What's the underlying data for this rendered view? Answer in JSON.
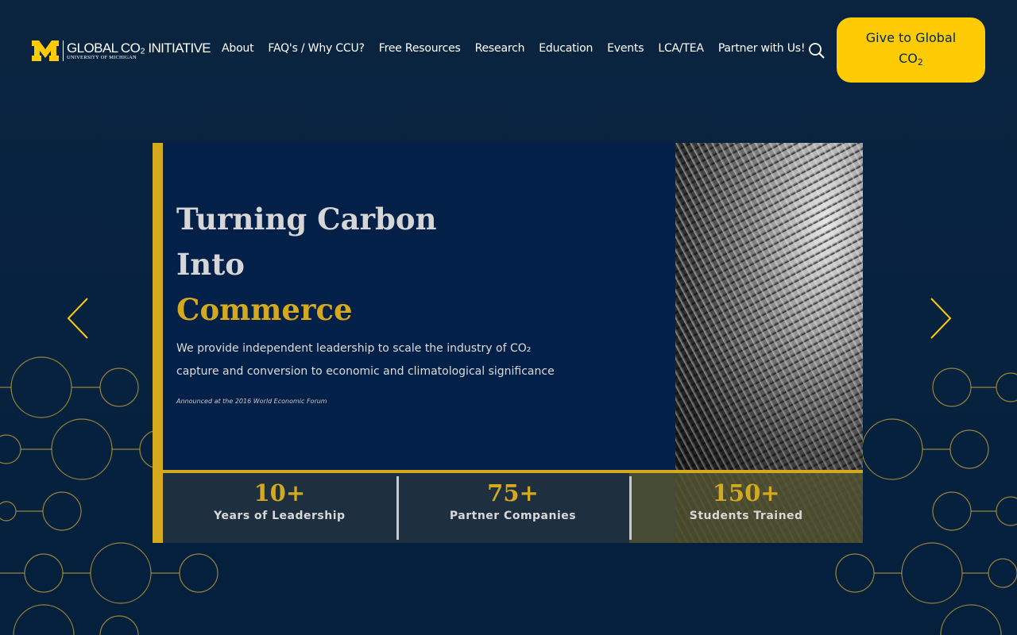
{
  "header": {
    "logo": {
      "title": "GLOBAL CO₂ INITIATIVE",
      "subtitle": "University of Michigan"
    },
    "nav": [
      {
        "label": "About"
      },
      {
        "label": "FAQ's / Why CCU?"
      },
      {
        "label": "Free Resources"
      },
      {
        "label": "Research"
      },
      {
        "label": "Education"
      },
      {
        "label": "Events"
      },
      {
        "label": "LCA/TEA"
      },
      {
        "label": "Partner with Us!"
      }
    ],
    "search_icon": "search-icon",
    "give_button": {
      "line1": "Give to Global",
      "line2": "CO",
      "sub": "2"
    }
  },
  "slide": {
    "title_line1": "Turning Carbon",
    "title_line2": "Into",
    "title_accent": "Commerce",
    "description": "We provide independent leadership to scale the industry of CO₂ capture and conversion to economic and climatological significance",
    "note": "Announced at the 2016 World Economic Forum",
    "stats": [
      {
        "value": "10+",
        "label": "Years of Leadership"
      },
      {
        "value": "75+",
        "label": "Partner Companies"
      },
      {
        "value": "150+",
        "label": "Students Trained"
      }
    ]
  },
  "controls": {
    "prev_icon": "chevron-left-icon",
    "next_icon": "chevron-right-icon"
  },
  "colors": {
    "background": "#04203d",
    "accent": "#ffcb05",
    "gold": "#d4a91d",
    "text": "#ffffff"
  }
}
